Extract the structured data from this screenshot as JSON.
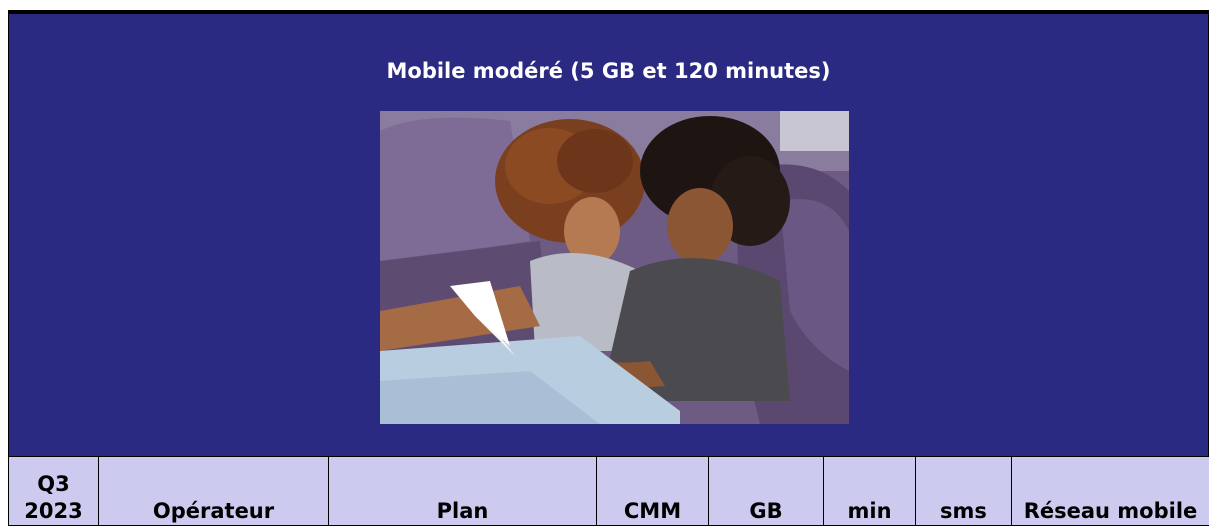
{
  "banner": {
    "title": "Mobile modéré (5 GB et 120 minutes)",
    "background_color": "#2b2a83",
    "image_alt": "Mother and daughter reading a book on a purple sofa"
  },
  "table": {
    "header_background": "#cccaee",
    "columns": [
      "Q3 2023",
      "Opérateur",
      "Plan",
      "CMM",
      "GB",
      "min",
      "sms",
      "Réseau mobile"
    ]
  }
}
